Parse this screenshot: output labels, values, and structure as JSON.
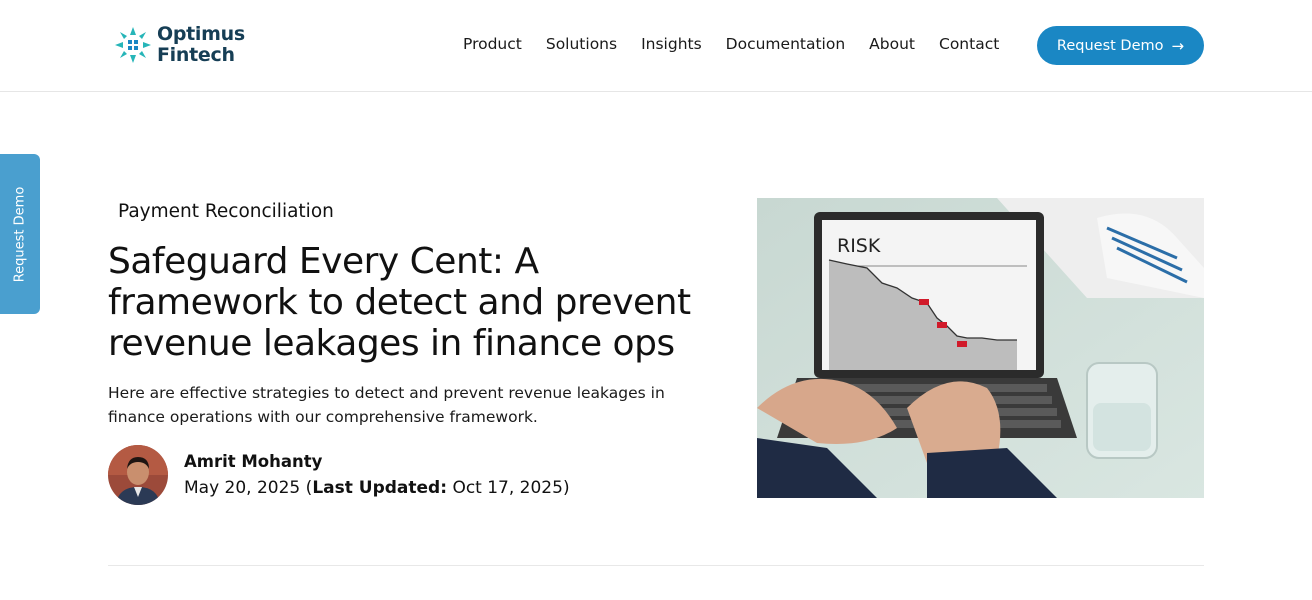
{
  "brand": {
    "line1": "Optimus",
    "line2": "Fintech"
  },
  "nav": [
    "Product",
    "Solutions",
    "Insights",
    "Documentation",
    "About",
    "Contact"
  ],
  "cta": {
    "label": "Request Demo",
    "arrow": "→"
  },
  "side_tab": {
    "label": "Request Demo"
  },
  "hero": {
    "category": "Payment Reconciliation",
    "title": "Safeguard Every Cent: A framework to detect and prevent revenue leakages in finance ops",
    "description": "Here are effective strategies to detect and prevent revenue leakages in finance operations with our comprehensive framework.",
    "author": {
      "name": "Amrit Mohanty",
      "published": "May 20, 2025",
      "updated_label": "Last Updated:",
      "updated": "Oct 17, 2025"
    },
    "image_text": "RISK"
  },
  "colors": {
    "brand": "#163e55",
    "accent": "#1a87c4",
    "side_tab": "#4a9fcf"
  }
}
